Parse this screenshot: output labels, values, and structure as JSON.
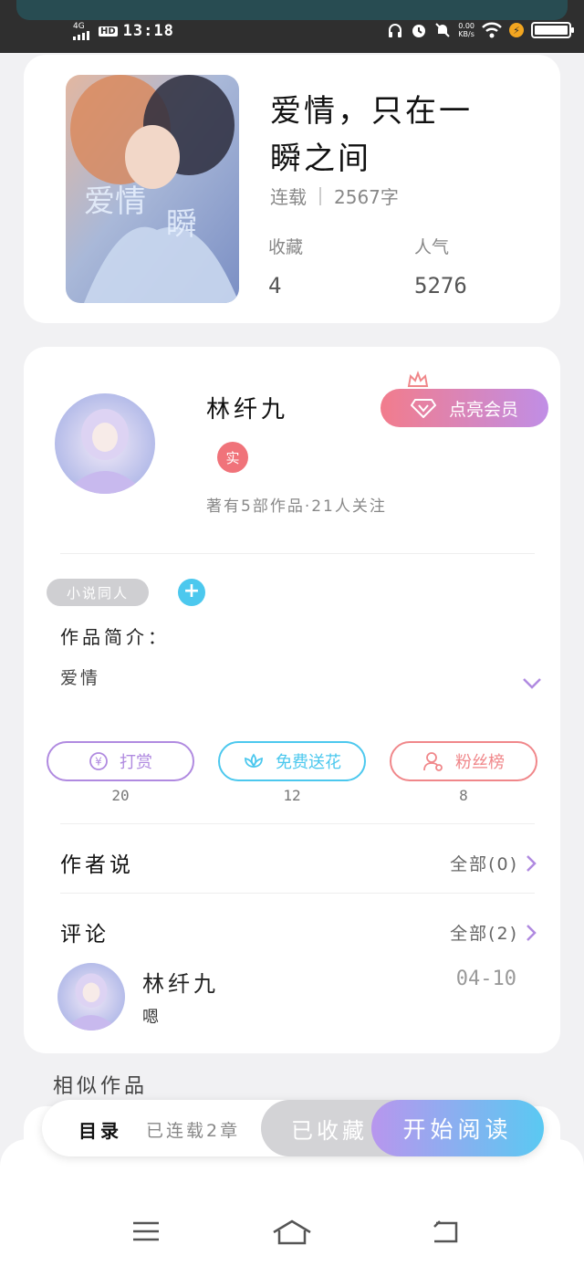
{
  "status_bar": {
    "network": "4G",
    "hd": "HD",
    "time": "13:18",
    "speed_value": "0.00",
    "speed_unit": "KB/s",
    "battery_level": 1.0
  },
  "book": {
    "title": "爱情，只在一瞬之间",
    "status": "连载",
    "word_count": "2567字",
    "favorites_label": "收藏",
    "favorites_value": "4",
    "popularity_label": "人气",
    "popularity_value": "5276"
  },
  "author": {
    "name": "林纤九",
    "verified_badge": "实",
    "summary": "著有5部作品·21人关注",
    "vip_button": "点亮会员"
  },
  "tags": {
    "items": [
      "小说同人"
    ],
    "add_label": "+"
  },
  "intro": {
    "title": "作品简介：",
    "body": "爱情"
  },
  "actions": [
    {
      "label": "打赏",
      "count": "20",
      "color": "#b08ae0"
    },
    {
      "label": "免费送花",
      "count": "12",
      "color": "#4cc8ee"
    },
    {
      "label": "粉丝榜",
      "count": "8",
      "color": "#f0878a"
    }
  ],
  "author_says": {
    "title": "作者说",
    "more": "全部(0)"
  },
  "comments": {
    "title": "评论",
    "more": "全部(2)",
    "items": [
      {
        "user": "林纤九",
        "date": "04-10",
        "text": "嗯"
      }
    ]
  },
  "similar": {
    "title": "相似作品"
  },
  "bottom_bar": {
    "toc": "目录",
    "chapters": "已连载2章",
    "favorited": "已收藏",
    "start_reading": "开始阅读"
  },
  "colors": {
    "accent_purple": "#b08ae0",
    "accent_blue": "#4cc8ee",
    "accent_pink": "#f0878a"
  }
}
